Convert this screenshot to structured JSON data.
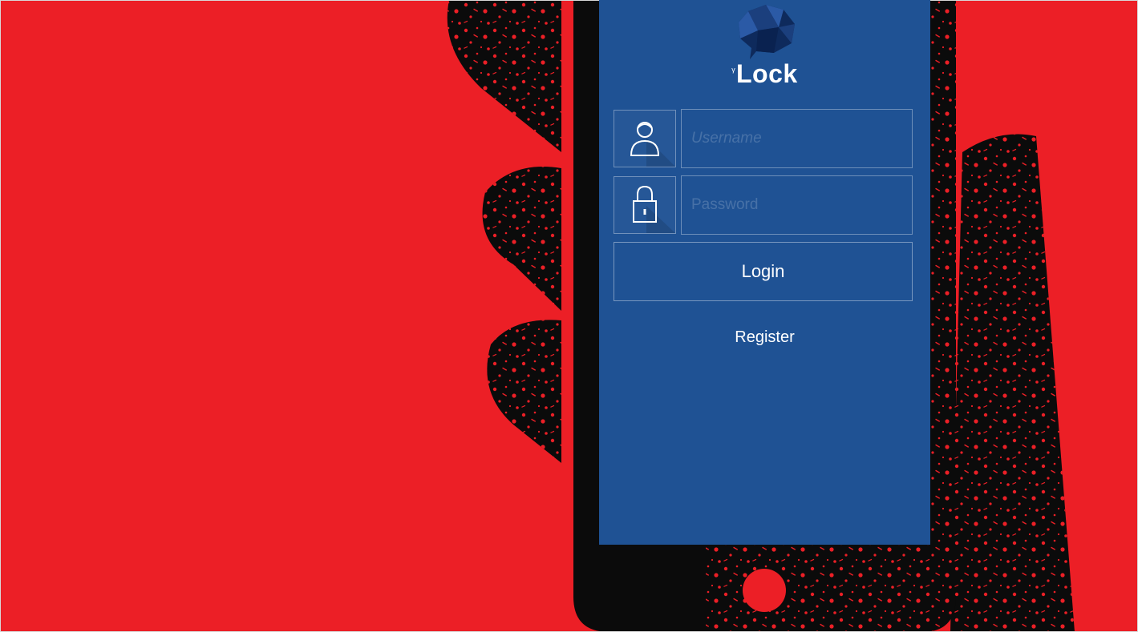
{
  "app": {
    "logo_prefix": "ᵧ",
    "logo_text": "Lock",
    "logo_icon": "chat-bubble-gem-icon"
  },
  "login_form": {
    "username_placeholder": "Username",
    "password_placeholder": "Password",
    "username_icon": "user-icon",
    "password_icon": "padlock-icon",
    "login_label": "Login",
    "register_label": "Register"
  },
  "colors": {
    "background_red": "#ec1f26",
    "phone_black": "#0b0b0b",
    "screen_blue": "#1f5294",
    "logo_blue_dark": "#0e2a5c",
    "logo_blue_mid": "#2b5aa6",
    "text_white": "#ffffff"
  }
}
